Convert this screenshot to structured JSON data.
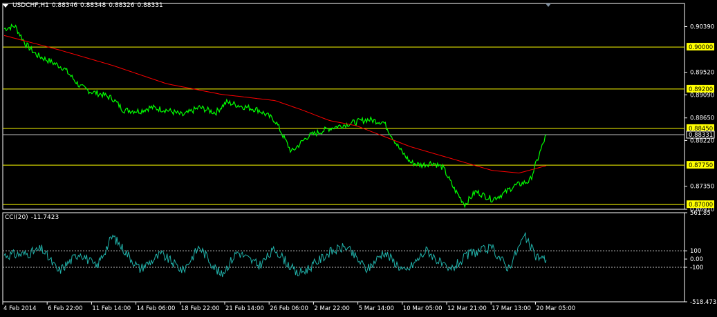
{
  "header": {
    "symbol": "USDCHF,H1",
    "open": "0.88346",
    "high": "0.88348",
    "low": "0.88326",
    "close": "0.88331"
  },
  "cci_header": {
    "name": "CCI(20)",
    "value": "-11.7423"
  },
  "colors": {
    "background": "#000000",
    "price": "#00ff00",
    "ma": "#ff0000",
    "level": "#ffff00",
    "cci": "#20b2aa",
    "axis": "#ffffff"
  },
  "chart_data": [
    {
      "type": "line",
      "title": "USDCHF,H1",
      "ylim": [
        0.8691,
        0.9083
      ],
      "y_ticks": [
        "0.90390",
        "0.89520",
        "0.89090",
        "0.88650",
        "0.88220",
        "0.87350",
        "0.86910"
      ],
      "horizontal_levels": [
        "0.90000",
        "0.89200",
        "0.88450",
        "0.87750",
        "0.87000"
      ],
      "current_price": "0.88331",
      "x_ticks": [
        "4 Feb 2014",
        "6 Feb 22:00",
        "11 Feb 14:00",
        "14 Feb 06:00",
        "18 Feb 22:00",
        "21 Feb 14:00",
        "26 Feb 06:00",
        "2 Mar 22:00",
        "5 Mar 14:00",
        "10 Mar 05:00",
        "12 Mar 21:00",
        "17 Mar 13:00",
        "20 Mar 05:00"
      ],
      "series": [
        {
          "role": "price",
          "x": [
            0,
            2,
            4,
            6,
            8,
            11,
            14,
            16,
            18,
            20,
            22,
            25,
            27,
            30,
            33,
            36,
            39,
            41,
            44,
            47,
            50,
            53,
            56,
            60,
            64,
            67,
            70,
            73,
            75,
            77,
            79,
            81,
            83,
            85,
            87,
            90,
            92,
            94,
            97,
            100
          ],
          "y": [
            0.9035,
            0.904,
            0.9005,
            0.8985,
            0.8975,
            0.896,
            0.8925,
            0.8915,
            0.891,
            0.8902,
            0.888,
            0.8878,
            0.8885,
            0.888,
            0.887,
            0.8885,
            0.8875,
            0.8895,
            0.8887,
            0.888,
            0.886,
            0.88,
            0.883,
            0.8845,
            0.8855,
            0.8862,
            0.8857,
            0.8805,
            0.878,
            0.8775,
            0.878,
            0.877,
            0.873,
            0.87,
            0.8725,
            0.871,
            0.872,
            0.8735,
            0.8745,
            0.8833
          ]
        },
        {
          "role": "moving-average",
          "x": [
            0,
            10,
            20,
            30,
            40,
            50,
            55,
            60,
            65,
            70,
            75,
            80,
            85,
            90,
            95,
            100
          ],
          "y": [
            0.9022,
            0.8995,
            0.8965,
            0.893,
            0.891,
            0.8898,
            0.888,
            0.886,
            0.885,
            0.883,
            0.881,
            0.8795,
            0.878,
            0.8765,
            0.876,
            0.8774
          ]
        }
      ]
    },
    {
      "type": "line",
      "title": "CCI(20)",
      "ylim": [
        -518.4735,
        561.85
      ],
      "y_ticks": [
        "561.85",
        "100",
        "0.00",
        "-100",
        "-518.4735"
      ],
      "reference_levels": [
        100,
        -100
      ],
      "series": [
        {
          "role": "cci",
          "x": [
            0,
            4,
            7,
            10,
            14,
            17,
            20,
            25,
            29,
            33,
            36,
            40,
            43,
            47,
            50,
            54,
            56,
            60,
            63,
            67,
            70,
            74,
            78,
            82,
            86,
            90,
            93,
            96,
            98,
            100
          ],
          "y": [
            50,
            60,
            120,
            -150,
            80,
            -100,
            280,
            -120,
            60,
            -140,
            150,
            -200,
            90,
            -80,
            120,
            -180,
            -120,
            80,
            150,
            -130,
            90,
            -160,
            110,
            -150,
            70,
            130,
            -110,
            280,
            40,
            -12
          ]
        }
      ]
    }
  ]
}
